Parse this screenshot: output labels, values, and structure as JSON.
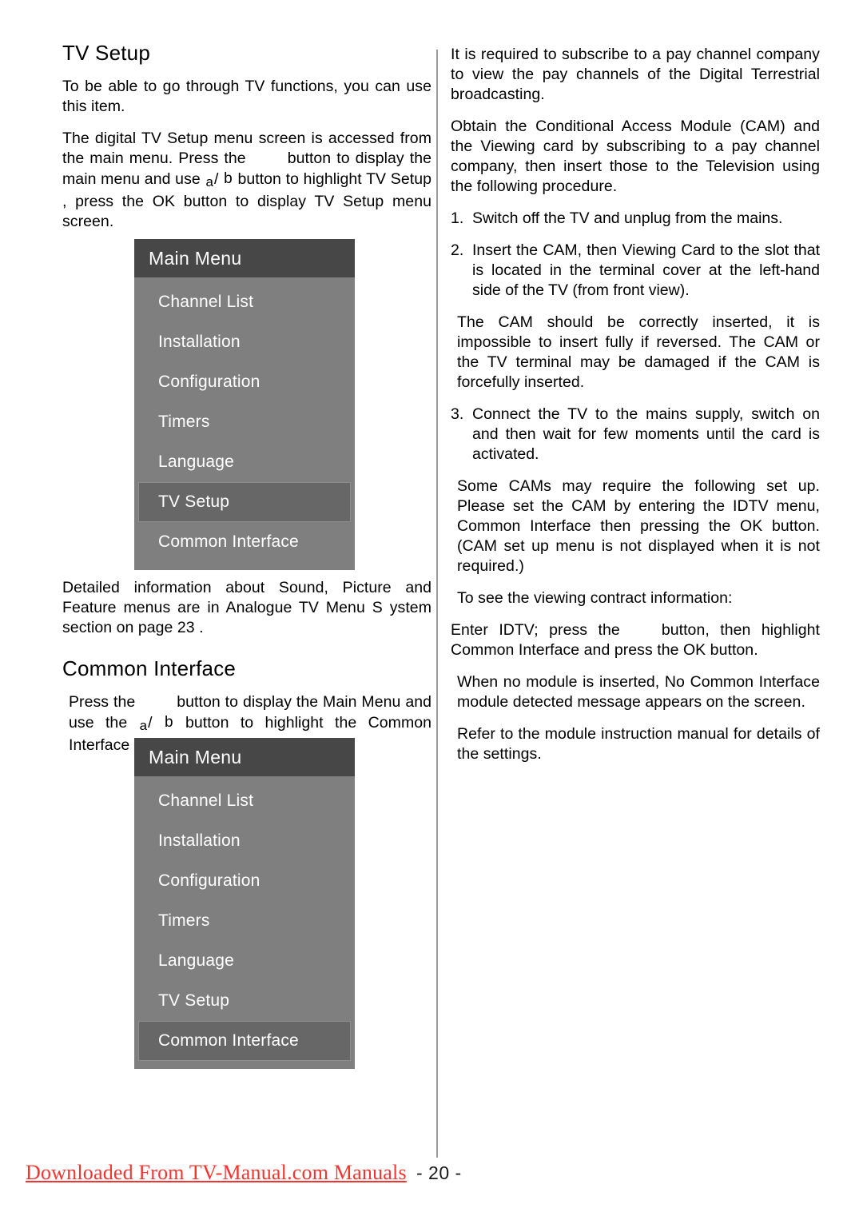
{
  "document": {
    "page_number_label": "- 20 -",
    "watermark": "Downloaded From TV-Manual.com Manuals"
  },
  "left_column": {
    "heading_tv_setup": "TV Setup",
    "p1": "To be able to go through TV functions, you can use this item.",
    "p2_a": "The digital TV Setup menu screen is accessed from the main menu. Press the",
    "p2_b": "button to display the main menu and use",
    "glyph_a": "a",
    "glyph_slash": "/",
    "glyph_b": "b",
    "p2_c": "button to highlight  TV Setup , press the OK button to display TV Setup menu screen.",
    "p3": "Detailed information about Sound, Picture and Feature menus are in Analogue TV Menu S ystem section on page 23 .",
    "heading_common_interface": "Common Interface",
    "p4_a": "Press the",
    "p4_b": "button to display the Main Menu and use the",
    "p4_c": "button to highlight the  Common Interface   line and press the OK button."
  },
  "right_column": {
    "p1": "It is required to subscribe to a pay channel company to view the pay channels of the Digital Terrestrial broadcasting.",
    "p2": "Obtain the Conditional Access Module (CAM) and the Viewing card by subscribing to a pay channel company, then insert those to the Television using the following procedure.",
    "step1_num": "1.",
    "step1_text": "Switch off the TV and unplug from the mains.",
    "step2_num": "2.",
    "step2_text": "Insert the CAM, then Viewing Card to the slot that is located in the terminal cover at the left-hand side of the TV (from front view).",
    "note1": "The CAM should be correctly inserted, it is impossible to insert fully if reversed. The CAM or the TV terminal may be damaged if the CAM is forcefully inserted.",
    "step3_num": "3.",
    "step3_text": "Connect the TV to the mains supply, switch on and then wait for few moments until the card is activated.",
    "note2": "Some CAMs may require the following set up. Please set the CAM by entering the IDTV menu, Common Interface then pressing the OK button. (CAM set up menu is not displayed when it is not required.)",
    "note3": "To see the viewing contract information:",
    "p5_a": "Enter IDTV; press the",
    "p5_b": "button, then highlight Common Interface  and press the OK button.",
    "note4": "When no module is inserted,  No Common Interface  module detected   message appears on the screen.",
    "note5": "Refer to the module instruction manual for details of the settings."
  },
  "osd_menu_tv_setup": {
    "title": "Main Menu",
    "items": [
      {
        "label": "Channel List",
        "selected": false
      },
      {
        "label": "Installation",
        "selected": false
      },
      {
        "label": "Configuration",
        "selected": false
      },
      {
        "label": "Timers",
        "selected": false
      },
      {
        "label": "Language",
        "selected": false
      },
      {
        "label": "TV Setup",
        "selected": true
      },
      {
        "label": "Common Interface",
        "selected": false
      }
    ]
  },
  "osd_menu_common_interface": {
    "title": "Main Menu",
    "items": [
      {
        "label": "Channel List",
        "selected": false
      },
      {
        "label": "Installation",
        "selected": false
      },
      {
        "label": "Configuration",
        "selected": false
      },
      {
        "label": "Timers",
        "selected": false
      },
      {
        "label": "Language",
        "selected": false
      },
      {
        "label": "TV Setup",
        "selected": false
      },
      {
        "label": "Common Interface",
        "selected": true
      }
    ]
  },
  "colors": {
    "osd_header_bg": "#474747",
    "osd_body_bg": "#7f7f7f",
    "osd_selected_bg": "#676767",
    "osd_text": "#ffffff",
    "watermark_red": "#f4352f",
    "divider": "#9a9a9a"
  }
}
